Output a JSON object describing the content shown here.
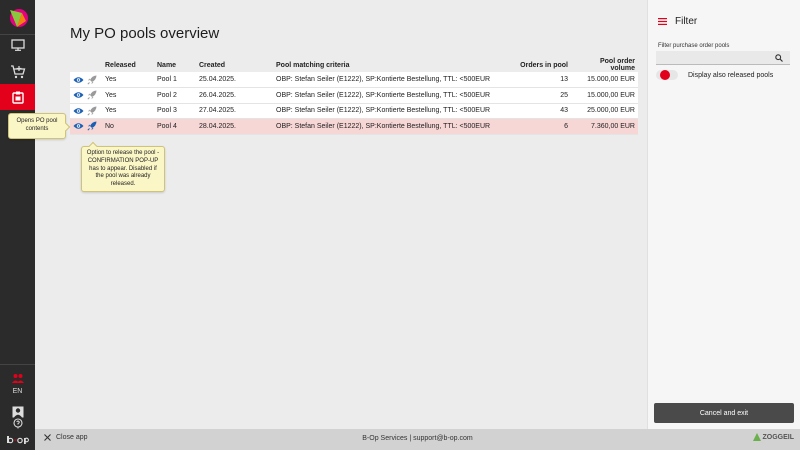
{
  "header": {
    "title": "My PO pools overview"
  },
  "table": {
    "columns": [
      "Released",
      "Name",
      "Created",
      "Pool matching criteria",
      "Orders in pool",
      "Pool order volume"
    ],
    "rows": [
      {
        "released": "Yes",
        "name": "Pool 1",
        "created": "25.04.2025.",
        "criteria": "OBP: Stefan Seiler (E1222), SP:Kontierte Bestellung, TTL: <500EUR",
        "orders": "13",
        "volume": "15.000,00 EUR"
      },
      {
        "released": "Yes",
        "name": "Pool 2",
        "created": "26.04.2025.",
        "criteria": "OBP: Stefan Seiler (E1222), SP:Kontierte Bestellung, TTL: <500EUR",
        "orders": "25",
        "volume": "15.000,00 EUR"
      },
      {
        "released": "Yes",
        "name": "Pool 3",
        "created": "27.04.2025.",
        "criteria": "OBP: Stefan Seiler (E1222), SP:Kontierte Bestellung, TTL: <500EUR",
        "orders": "43",
        "volume": "25.000,00 EUR"
      },
      {
        "released": "No",
        "name": "Pool 4",
        "created": "28.04.2025.",
        "criteria": "OBP: Stefan Seiler (E1222), SP:Kontierte Bestellung, TTL: <500EUR",
        "orders": "6",
        "volume": "7.360,00 EUR"
      }
    ]
  },
  "tooltips": {
    "view": "Opens PO pool contents",
    "release": "Option to release the pool - CONFIRMATION POP-UP has to appear. Disabled if the pool was already released."
  },
  "filter": {
    "title": "Filter",
    "search_label": "Filter purchase order pools",
    "search_value": "",
    "toggle_label": "Display also released pools",
    "cancel_label": "Cancel and exit"
  },
  "sidebar": {
    "language": "EN"
  },
  "footer": {
    "close_label": "Close app",
    "service_text": "B-Op Services | support@b-op.com",
    "brand": "ZOGGEIL"
  },
  "colors": {
    "accent": "#e2001a",
    "icon_blue": "#1a5fb4",
    "highlight_row": "#f7d6d6",
    "rail": "#2b2b2b"
  },
  "icons": {
    "view": "eye-icon",
    "release": "rocket-icon",
    "search": "search-icon",
    "filter": "menu-icon",
    "close": "close-icon"
  }
}
